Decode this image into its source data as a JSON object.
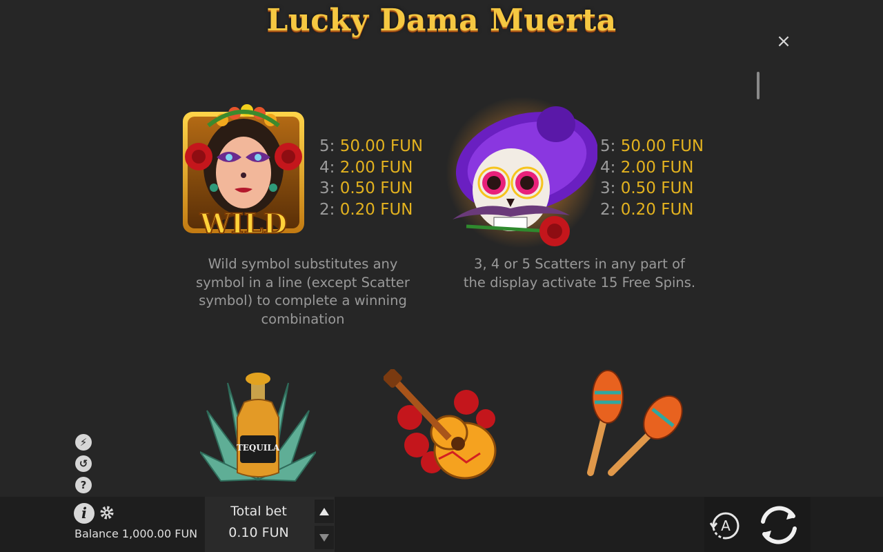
{
  "game": {
    "title": "Lucky Dama Muerta"
  },
  "controls": {
    "close_icon": "×",
    "info_icon": "i",
    "help_icon": "?"
  },
  "wild": {
    "symbol_label": "WILD",
    "paytable": [
      {
        "count": "5:",
        "value": "50.00 FUN"
      },
      {
        "count": "4:",
        "value": "2.00 FUN"
      },
      {
        "count": "3:",
        "value": "0.50 FUN"
      },
      {
        "count": "2:",
        "value": "0.20 FUN"
      }
    ],
    "description_lines": [
      "Wild symbol substitutes any",
      "symbol in a line (except Scatter",
      "symbol) to complete a winning",
      "combination"
    ]
  },
  "scatter": {
    "paytable": [
      {
        "count": "5:",
        "value": "50.00 FUN"
      },
      {
        "count": "4:",
        "value": "2.00 FUN"
      },
      {
        "count": "3:",
        "value": "0.50 FUN"
      },
      {
        "count": "2:",
        "value": "0.20 FUN"
      }
    ],
    "description_lines": [
      "3, 4 or 5 Scatters in any part of",
      "the display activate 15 Free Spins."
    ]
  },
  "symbols_row2": {
    "tequila_label": "TEQUILA"
  },
  "bottom": {
    "balance": "Balance 1,000.00 FUN",
    "total_bet_label": "Total bet",
    "total_bet_value": "0.10 FUN",
    "autoplay_letter": "A"
  },
  "colors": {
    "background": "#262626",
    "pay_value": "#e3b21f",
    "title_gold": "#f5c842",
    "scatter_hat": "#7a2bd6"
  }
}
